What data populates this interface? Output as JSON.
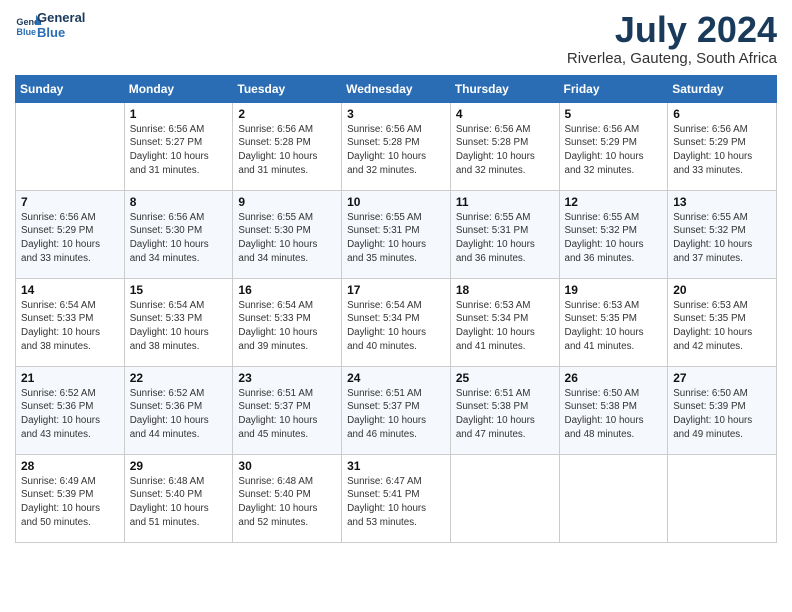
{
  "header": {
    "logo_line1": "General",
    "logo_line2": "Blue",
    "month_year": "July 2024",
    "location": "Riverlea, Gauteng, South Africa"
  },
  "days_of_week": [
    "Sunday",
    "Monday",
    "Tuesday",
    "Wednesday",
    "Thursday",
    "Friday",
    "Saturday"
  ],
  "weeks": [
    [
      {
        "day": "",
        "sunrise": "",
        "sunset": "",
        "daylight": ""
      },
      {
        "day": "1",
        "sunrise": "6:56 AM",
        "sunset": "5:27 PM",
        "daylight": "10 hours and 31 minutes."
      },
      {
        "day": "2",
        "sunrise": "6:56 AM",
        "sunset": "5:28 PM",
        "daylight": "10 hours and 31 minutes."
      },
      {
        "day": "3",
        "sunrise": "6:56 AM",
        "sunset": "5:28 PM",
        "daylight": "10 hours and 32 minutes."
      },
      {
        "day": "4",
        "sunrise": "6:56 AM",
        "sunset": "5:28 PM",
        "daylight": "10 hours and 32 minutes."
      },
      {
        "day": "5",
        "sunrise": "6:56 AM",
        "sunset": "5:29 PM",
        "daylight": "10 hours and 32 minutes."
      },
      {
        "day": "6",
        "sunrise": "6:56 AM",
        "sunset": "5:29 PM",
        "daylight": "10 hours and 33 minutes."
      }
    ],
    [
      {
        "day": "7",
        "sunrise": "6:56 AM",
        "sunset": "5:29 PM",
        "daylight": "10 hours and 33 minutes."
      },
      {
        "day": "8",
        "sunrise": "6:56 AM",
        "sunset": "5:30 PM",
        "daylight": "10 hours and 34 minutes."
      },
      {
        "day": "9",
        "sunrise": "6:55 AM",
        "sunset": "5:30 PM",
        "daylight": "10 hours and 34 minutes."
      },
      {
        "day": "10",
        "sunrise": "6:55 AM",
        "sunset": "5:31 PM",
        "daylight": "10 hours and 35 minutes."
      },
      {
        "day": "11",
        "sunrise": "6:55 AM",
        "sunset": "5:31 PM",
        "daylight": "10 hours and 36 minutes."
      },
      {
        "day": "12",
        "sunrise": "6:55 AM",
        "sunset": "5:32 PM",
        "daylight": "10 hours and 36 minutes."
      },
      {
        "day": "13",
        "sunrise": "6:55 AM",
        "sunset": "5:32 PM",
        "daylight": "10 hours and 37 minutes."
      }
    ],
    [
      {
        "day": "14",
        "sunrise": "6:54 AM",
        "sunset": "5:33 PM",
        "daylight": "10 hours and 38 minutes."
      },
      {
        "day": "15",
        "sunrise": "6:54 AM",
        "sunset": "5:33 PM",
        "daylight": "10 hours and 38 minutes."
      },
      {
        "day": "16",
        "sunrise": "6:54 AM",
        "sunset": "5:33 PM",
        "daylight": "10 hours and 39 minutes."
      },
      {
        "day": "17",
        "sunrise": "6:54 AM",
        "sunset": "5:34 PM",
        "daylight": "10 hours and 40 minutes."
      },
      {
        "day": "18",
        "sunrise": "6:53 AM",
        "sunset": "5:34 PM",
        "daylight": "10 hours and 41 minutes."
      },
      {
        "day": "19",
        "sunrise": "6:53 AM",
        "sunset": "5:35 PM",
        "daylight": "10 hours and 41 minutes."
      },
      {
        "day": "20",
        "sunrise": "6:53 AM",
        "sunset": "5:35 PM",
        "daylight": "10 hours and 42 minutes."
      }
    ],
    [
      {
        "day": "21",
        "sunrise": "6:52 AM",
        "sunset": "5:36 PM",
        "daylight": "10 hours and 43 minutes."
      },
      {
        "day": "22",
        "sunrise": "6:52 AM",
        "sunset": "5:36 PM",
        "daylight": "10 hours and 44 minutes."
      },
      {
        "day": "23",
        "sunrise": "6:51 AM",
        "sunset": "5:37 PM",
        "daylight": "10 hours and 45 minutes."
      },
      {
        "day": "24",
        "sunrise": "6:51 AM",
        "sunset": "5:37 PM",
        "daylight": "10 hours and 46 minutes."
      },
      {
        "day": "25",
        "sunrise": "6:51 AM",
        "sunset": "5:38 PM",
        "daylight": "10 hours and 47 minutes."
      },
      {
        "day": "26",
        "sunrise": "6:50 AM",
        "sunset": "5:38 PM",
        "daylight": "10 hours and 48 minutes."
      },
      {
        "day": "27",
        "sunrise": "6:50 AM",
        "sunset": "5:39 PM",
        "daylight": "10 hours and 49 minutes."
      }
    ],
    [
      {
        "day": "28",
        "sunrise": "6:49 AM",
        "sunset": "5:39 PM",
        "daylight": "10 hours and 50 minutes."
      },
      {
        "day": "29",
        "sunrise": "6:48 AM",
        "sunset": "5:40 PM",
        "daylight": "10 hours and 51 minutes."
      },
      {
        "day": "30",
        "sunrise": "6:48 AM",
        "sunset": "5:40 PM",
        "daylight": "10 hours and 52 minutes."
      },
      {
        "day": "31",
        "sunrise": "6:47 AM",
        "sunset": "5:41 PM",
        "daylight": "10 hours and 53 minutes."
      },
      {
        "day": "",
        "sunrise": "",
        "sunset": "",
        "daylight": ""
      },
      {
        "day": "",
        "sunrise": "",
        "sunset": "",
        "daylight": ""
      },
      {
        "day": "",
        "sunrise": "",
        "sunset": "",
        "daylight": ""
      }
    ]
  ],
  "labels": {
    "sunrise_prefix": "Sunrise: ",
    "sunset_prefix": "Sunset: ",
    "daylight_prefix": "Daylight: "
  }
}
